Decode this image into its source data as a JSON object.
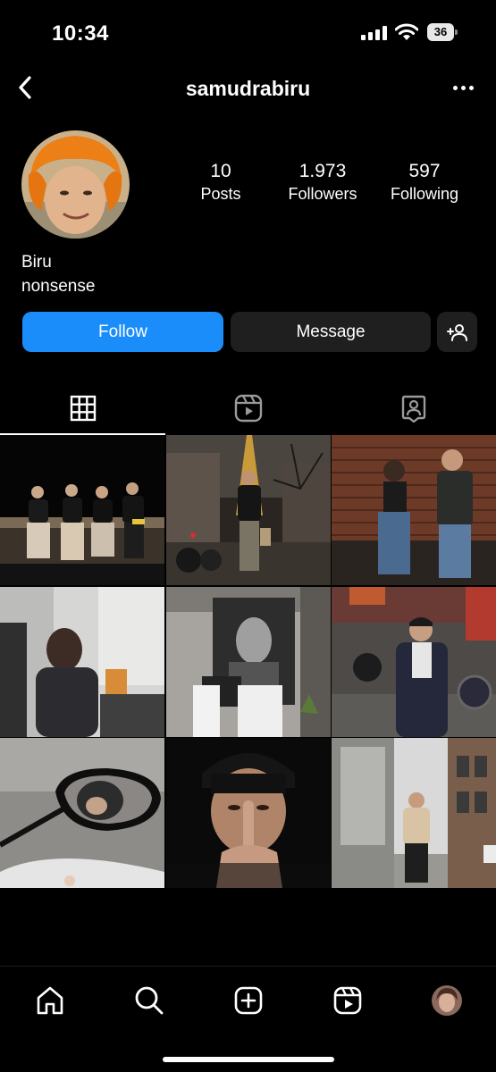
{
  "status_bar": {
    "time": "10:34",
    "battery": "36",
    "icons": [
      "cellular-signal-icon",
      "wifi-icon",
      "battery-icon"
    ]
  },
  "header": {
    "username": "samudrabiru",
    "back_icon": "chevron-left-icon",
    "more_icon": "more-horizontal-icon"
  },
  "profile": {
    "stats": [
      {
        "value": "10",
        "label": "Posts"
      },
      {
        "value": "1.973",
        "label": "Followers"
      },
      {
        "value": "597",
        "label": "Following"
      }
    ],
    "name": "Biru",
    "bio": "nonsense"
  },
  "actions": {
    "follow": "Follow",
    "message": "Message",
    "add_user_icon": "add-user-icon",
    "follow_color": "#1a8dfa",
    "secondary_color": "#1f1f1f"
  },
  "tabs": [
    {
      "icon": "grid-icon",
      "selected": true
    },
    {
      "icon": "reels-icon",
      "selected": false
    },
    {
      "icon": "tagged-icon",
      "selected": false
    }
  ],
  "posts_count_shown": 9,
  "bottom_nav": [
    "home-icon",
    "search-icon",
    "create-icon",
    "reels-icon",
    "profile-avatar"
  ]
}
